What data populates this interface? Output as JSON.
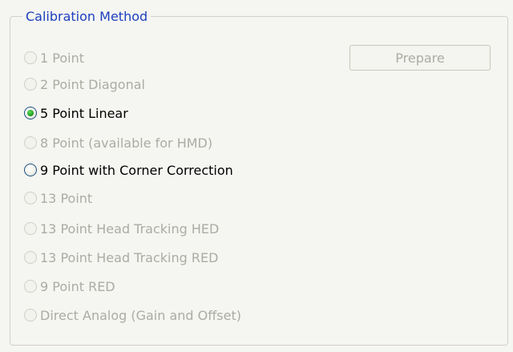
{
  "group": {
    "title": "Calibration Method",
    "colors": {
      "title": "#1c3fbd",
      "disabled_text": "#acaca4",
      "radio_check": "#21a121"
    }
  },
  "prepare_button": {
    "label": "Prepare",
    "enabled": false
  },
  "options": [
    {
      "label": "1 Point",
      "enabled": false,
      "selected": false
    },
    {
      "label": "2 Point Diagonal",
      "enabled": false,
      "selected": false
    },
    {
      "label": "5 Point Linear",
      "enabled": true,
      "selected": true
    },
    {
      "label": "8 Point (available for HMD)",
      "enabled": false,
      "selected": false
    },
    {
      "label": "9 Point with Corner Correction",
      "enabled": true,
      "selected": false
    },
    {
      "label": "13 Point",
      "enabled": false,
      "selected": false
    },
    {
      "label": "13 Point Head Tracking HED",
      "enabled": false,
      "selected": false
    },
    {
      "label": "13 Point Head Tracking RED",
      "enabled": false,
      "selected": false
    },
    {
      "label": "9 Point RED",
      "enabled": false,
      "selected": false
    },
    {
      "label": "Direct Analog (Gain and Offset)",
      "enabled": false,
      "selected": false
    }
  ]
}
